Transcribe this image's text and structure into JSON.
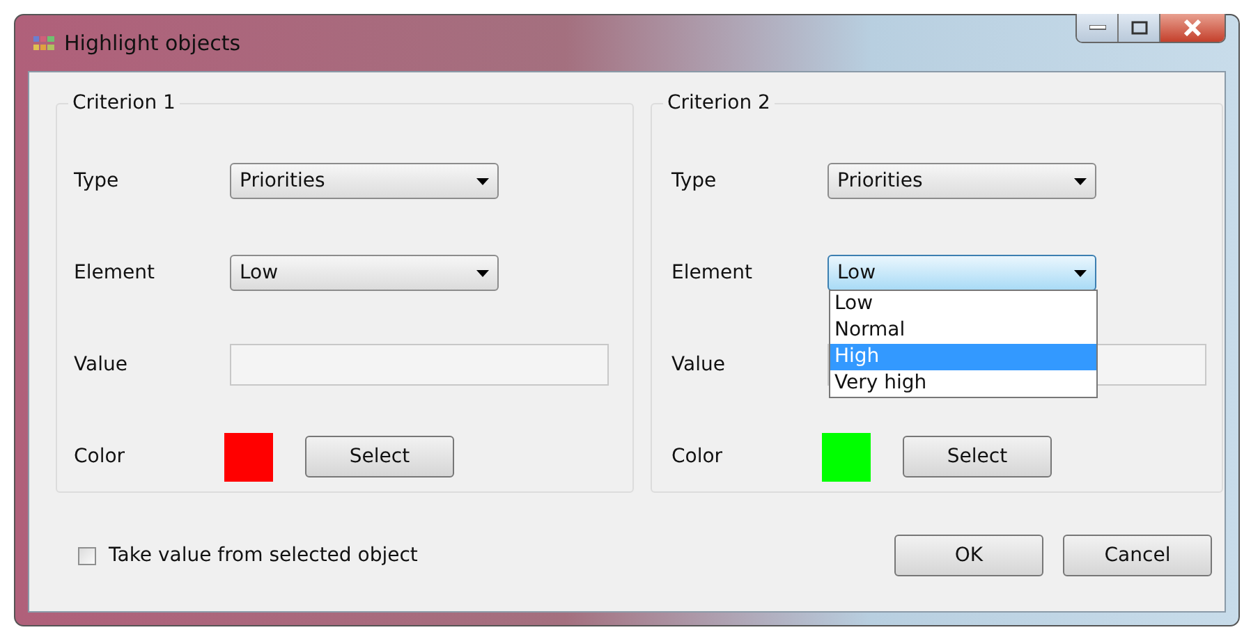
{
  "window": {
    "title": "Highlight objects"
  },
  "criteria": [
    {
      "title": "Criterion 1",
      "type_label": "Type",
      "type": "Priorities",
      "element_label": "Element",
      "element": "Low",
      "expanded": false,
      "value_label": "Value",
      "color_label": "Color",
      "color": "#ff0000",
      "select_button": "Select"
    },
    {
      "title": "Criterion 2",
      "type_label": "Type",
      "type": "Priorities",
      "element_label": "Element",
      "element": "Low",
      "expanded": true,
      "element_options": [
        {
          "label": "Low",
          "selected": false
        },
        {
          "label": "Normal",
          "selected": false
        },
        {
          "label": "High",
          "selected": true
        },
        {
          "label": "Very high",
          "selected": false
        }
      ],
      "value_label": "Value",
      "color_label": "Color",
      "color": "#00ff00",
      "select_button": "Select"
    }
  ],
  "take_value": {
    "label": "Take value from selected object",
    "checked": false
  },
  "buttons": [
    "OK",
    "Cancel"
  ]
}
